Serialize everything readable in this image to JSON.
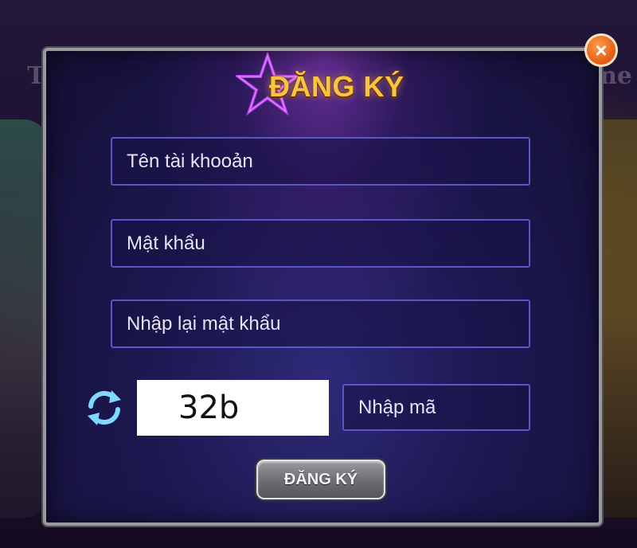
{
  "background": {
    "left_text": "T",
    "right_text": "ne"
  },
  "dialog": {
    "title": "ĐĂNG KÝ",
    "close_label": "×",
    "fields": {
      "username_placeholder": "Tên tài khooản",
      "password_placeholder": "Mật khẩu",
      "confirm_placeholder": "Nhập lại mật khẩu",
      "captcha_placeholder": "Nhập mã"
    },
    "captcha_code": "32b",
    "submit_label": "ĐĂNG KÝ"
  },
  "colors": {
    "accent": "#f7c640",
    "field_border": "#5a55c8",
    "close": "#e35a12"
  },
  "icons": [
    "close-icon",
    "star-icon",
    "refresh-icon"
  ]
}
